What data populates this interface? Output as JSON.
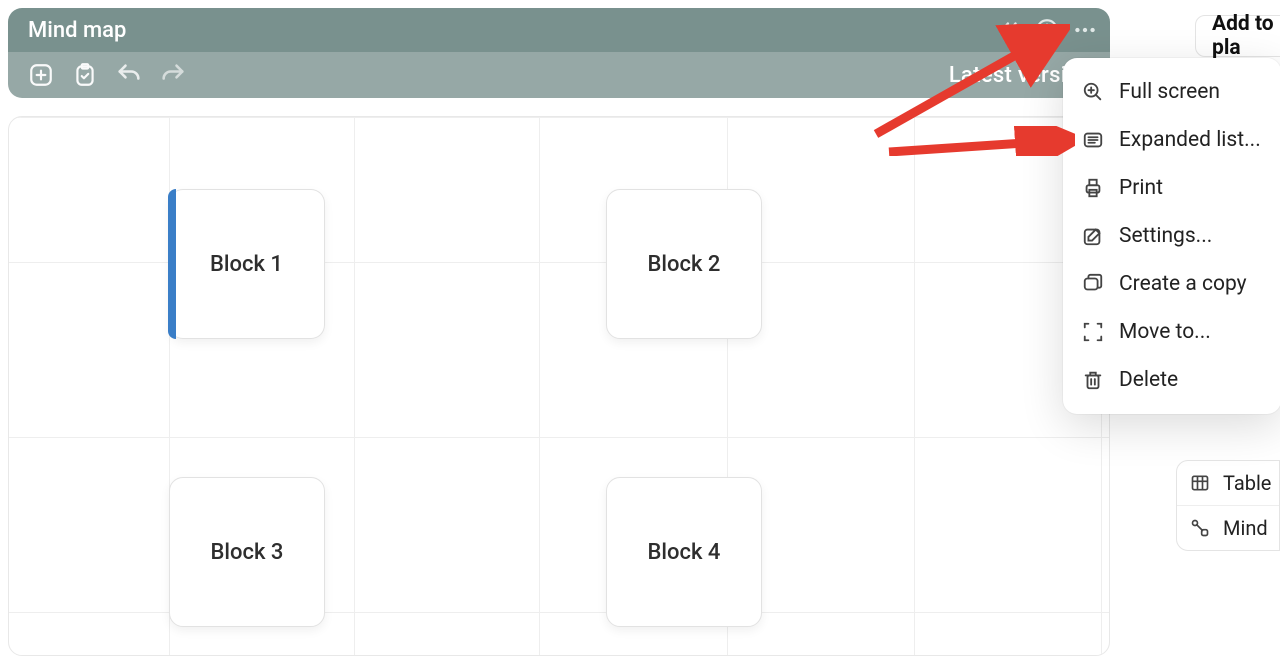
{
  "header": {
    "title": "Mind map",
    "version_label": "Latest version"
  },
  "blocks": [
    {
      "label": "Block 1",
      "selected": true
    },
    {
      "label": "Block 2",
      "selected": false
    },
    {
      "label": "Block 3",
      "selected": false
    },
    {
      "label": "Block 4",
      "selected": false
    }
  ],
  "side_button": "Add to pla",
  "menu": [
    {
      "label": "Full screen",
      "icon": "magnify-plus"
    },
    {
      "label": "Expanded list...",
      "icon": "list"
    },
    {
      "label": "Print",
      "icon": "printer"
    },
    {
      "label": "Settings...",
      "icon": "pencil-square"
    },
    {
      "label": "Create a copy",
      "icon": "copy-window"
    },
    {
      "label": "Move to...",
      "icon": "move"
    },
    {
      "label": "Delete",
      "icon": "trash"
    }
  ],
  "side_panel": [
    {
      "label": "Table",
      "icon": "table"
    },
    {
      "label": "Mind",
      "icon": "mind"
    }
  ]
}
